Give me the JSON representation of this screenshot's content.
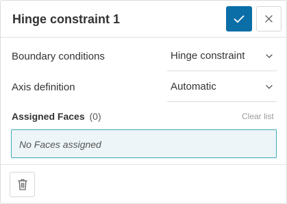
{
  "header": {
    "title": "Hinge constraint 1",
    "confirm_icon": "check-icon",
    "close_icon": "close-icon"
  },
  "fields": [
    {
      "label": "Boundary conditions",
      "value": "Hinge constraint",
      "icon": "chevron-down-icon"
    },
    {
      "label": "Axis definition",
      "value": "Automatic",
      "icon": "chevron-down-icon"
    }
  ],
  "assigned_faces": {
    "label": "Assigned Faces",
    "count": "(0)",
    "clear_label": "Clear list",
    "empty_text": "No Faces assigned"
  },
  "footer": {
    "delete_icon": "trash-icon"
  },
  "colors": {
    "accent": "#0b6ea6",
    "selection_border": "#3aa9b8",
    "selection_background": "#edf5f8"
  }
}
